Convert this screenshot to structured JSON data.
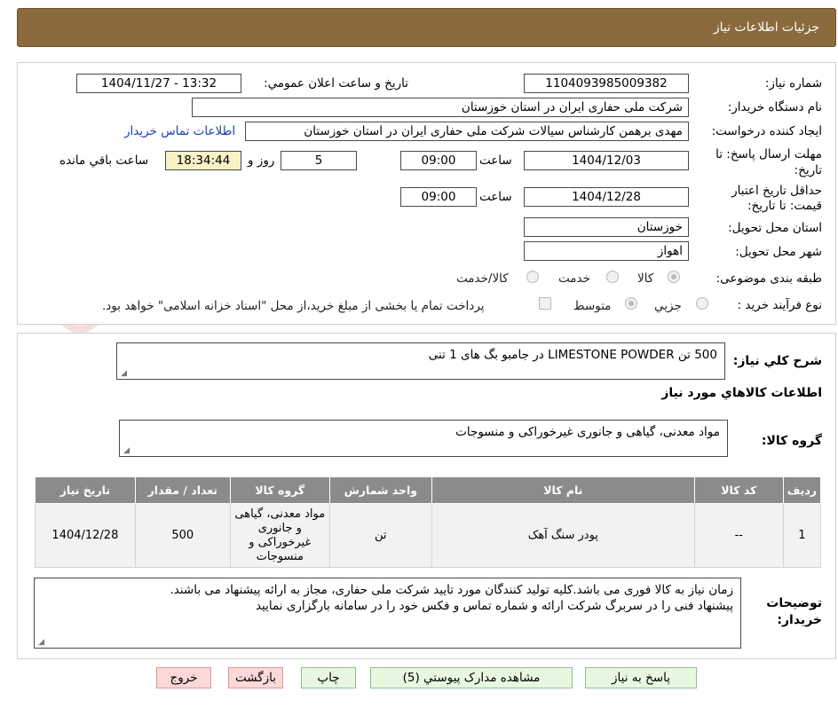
{
  "header": {
    "title": "جزئیات اطلاعات نیاز"
  },
  "watermark": {
    "text": "AriaTender.net"
  },
  "form": {
    "need_number_label": "شماره نیاز:",
    "need_number": "1104093985009382",
    "announce_label": "تاریخ و ساعت اعلان عمومي:",
    "announce_value": "1404/11/27 - 13:32",
    "buyer_label": "نام دستگاه خریدار:",
    "buyer_value": "شرکت ملی حفاری ایران در استان خوزستان",
    "creator_label": "ایجاد کننده درخواست:",
    "creator_value": "مهدی برهمن کارشناس سیالات شرکت ملی حفاری ایران در استان خوزستان",
    "contact_link": "اطلاعات تماس خریدار",
    "deadline_label_1": "مهلت ارسال پاسخ: تا",
    "deadline_label_2": "تاریخ:",
    "deadline_date": "1404/12/03",
    "time_label": "ساعت",
    "deadline_time": "09:00",
    "days_value": "5",
    "days_label": "روز و",
    "remaining_time": "18:34:44",
    "remaining_label": "ساعت باقي مانده",
    "validity_label_1": "حداقل تاریخ اعتبار",
    "validity_label_2": "قیمت: تا تاریخ:",
    "validity_date": "1404/12/28",
    "validity_time_label": "ساعت",
    "validity_time": "09:00",
    "province_label": "استان محل تحویل:",
    "province_value": "خوزستان",
    "city_label": "شهر محل تحویل:",
    "city_value": "اهواز",
    "category_label": "طبقه بندی موضوعی:",
    "category_options": [
      "کالا",
      "خدمت",
      "کالا/خدمت"
    ],
    "process_label": "نوع فرآیند خرید :",
    "process_options": [
      "جزیي",
      "متوسط"
    ],
    "process_note": "پرداخت تمام یا بخشی از مبلغ خرید،از محل \"اسناد خزانه اسلامی\" خواهد بود."
  },
  "summary": {
    "label": "شرح کلي نیاز:",
    "value": "500 تن LIMESTONE POWDER در جامبو بگ های 1 تنی"
  },
  "goods": {
    "section_title": "اطلاعات کالاهاي مورد نیاز",
    "group_label": "گروه کالا:",
    "group_value": "مواد معدنی، گیاهی و جانوری غیرخوراکی و منسوجات"
  },
  "table": {
    "headers": [
      "ردیف",
      "کد کالا",
      "نام کالا",
      "واحد شمارش",
      "گروه کالا",
      "تعداد / مقدار",
      "تاریخ نیاز"
    ],
    "rows": [
      [
        "1",
        "--",
        "پودر سنگ آهک",
        "تن",
        "مواد معدنی، گیاهی و جانوری غیرخوراکی و منسوجات",
        "500",
        "1404/12/28"
      ]
    ]
  },
  "notes": {
    "label_1": "توضیحات",
    "label_2": "خریدار:",
    "line_1": "زمان نیاز به کالا فوری می باشد.کلیه تولید کنندگان مورد تایید شرکت ملی حفاری، مجاز به ارائه پیشنهاد می باشند.",
    "line_2": "پیشنهاد فنی را در سربرگ شرکت ارائه و شماره تماس و فکس خود را در سامانه بارگزاری نمایید"
  },
  "buttons": {
    "reply": "پاسخ به نیاز",
    "attachments": "مشاهده مدارک پیوستي (5)",
    "print": "چاپ",
    "back": "بازگشت",
    "exit": "خروج"
  }
}
